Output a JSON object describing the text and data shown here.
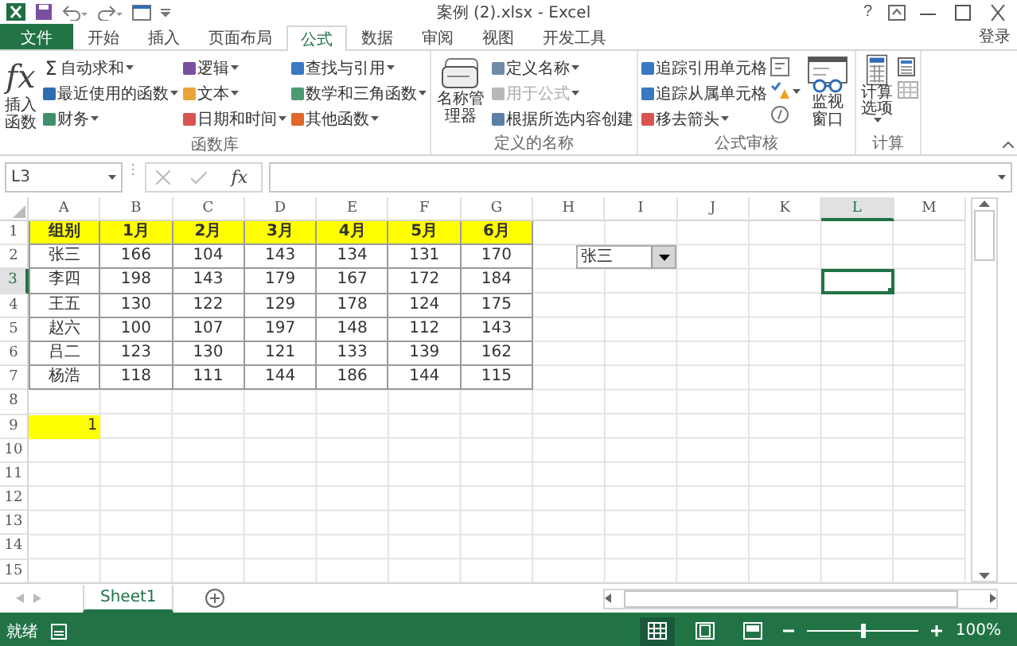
{
  "window": {
    "title": "案例 (2).xlsx - Excel",
    "help": "?"
  },
  "tabs": [
    {
      "label": "文件",
      "kind": "file",
      "selected": false
    },
    {
      "label": "开始",
      "kind": "tab",
      "selected": false
    },
    {
      "label": "插入",
      "kind": "tab",
      "selected": false
    },
    {
      "label": "页面布局",
      "kind": "tab",
      "selected": false
    },
    {
      "label": "公式",
      "kind": "tab",
      "selected": true
    },
    {
      "label": "数据",
      "kind": "tab",
      "selected": false
    },
    {
      "label": "审阅",
      "kind": "tab",
      "selected": false
    },
    {
      "label": "视图",
      "kind": "tab",
      "selected": false
    },
    {
      "label": "开发工具",
      "kind": "tab",
      "selected": false
    }
  ],
  "account": {
    "label": "登录"
  },
  "ribbon": {
    "groups": [
      {
        "label": "函数库",
        "controls": [
          {
            "kind": "function_button",
            "label": "插入函数",
            "symbol": "fx",
            "dropdown": false
          },
          {
            "kind": "stack",
            "items": [
              {
                "label": "自动求和",
                "symbol": "Σ",
                "dropdown": true,
                "disabled": false
              },
              {
                "label": "最近使用的函数",
                "color": "#2e6db4",
                "dropdown": true,
                "disabled": false
              },
              {
                "label": "财务",
                "color": "#3f8f6b",
                "dropdown": true,
                "disabled": false
              }
            ]
          },
          {
            "kind": "stack",
            "items": [
              {
                "label": "逻辑",
                "color": "#7b4fa0",
                "dropdown": true,
                "disabled": false
              },
              {
                "label": "文本",
                "color": "#e8a53a",
                "dropdown": true,
                "disabled": false
              },
              {
                "label": "日期和时间",
                "color": "#d9534f",
                "dropdown": true,
                "disabled": false
              }
            ]
          },
          {
            "kind": "stack",
            "items": [
              {
                "label": "查找与引用",
                "color": "#3a78c2",
                "dropdown": true,
                "disabled": false
              },
              {
                "label": "数学和三角函数",
                "color": "#4c9a72",
                "dropdown": true,
                "disabled": false
              },
              {
                "label": "其他函数",
                "color": "#e0662a",
                "dropdown": true,
                "disabled": false
              }
            ]
          }
        ]
      },
      {
        "label": "定义的名称",
        "controls": [
          {
            "kind": "name_manager",
            "label": "名称管理器",
            "dropdown": false
          },
          {
            "kind": "stack",
            "items": [
              {
                "label": "定义名称",
                "color": "#6f8ba8",
                "dropdown": true,
                "disabled": false
              },
              {
                "label": "用于公式",
                "color": "#b8b8b8",
                "dropdown": true,
                "disabled": true
              },
              {
                "label": "根据所选内容创建",
                "color": "#5b7fa6",
                "dropdown": false,
                "disabled": false
              }
            ]
          }
        ]
      },
      {
        "label": "公式审核",
        "controls": [
          {
            "kind": "stack",
            "items": [
              {
                "label": "追踪引用单元格",
                "color": "#3a78c2",
                "dropdown": false,
                "disabled": false
              },
              {
                "label": "追踪从属单元格",
                "color": "#3a78c2",
                "dropdown": false,
                "disabled": false
              },
              {
                "label": "移去箭头",
                "color": "#d9534f",
                "dropdown": true,
                "disabled": false
              }
            ]
          },
          {
            "kind": "icon_column",
            "items": [
              {
                "kind": "formulas",
                "dropdown": false
              },
              {
                "kind": "error_check",
                "dropdown": true
              },
              {
                "kind": "evaluate",
                "dropdown": false
              }
            ]
          },
          {
            "kind": "watch_window",
            "label": "监视窗口",
            "dropdown": false
          }
        ]
      },
      {
        "label": "计算",
        "controls": [
          {
            "kind": "calc_options",
            "label": "计算选项",
            "dropdown": true
          },
          {
            "kind": "icon_column",
            "items": [
              {
                "kind": "calculate_now",
                "dropdown": false
              },
              {
                "kind": "calculate_sheet",
                "dropdown": false
              }
            ]
          }
        ]
      }
    ]
  },
  "name_box": {
    "value": "L3"
  },
  "formula_bar": {
    "fx": "fx"
  },
  "sheet": {
    "columns": [
      {
        "label": "A",
        "selected": false
      },
      {
        "label": "B",
        "selected": false
      },
      {
        "label": "C",
        "selected": false
      },
      {
        "label": "D",
        "selected": false
      },
      {
        "label": "E",
        "selected": false
      },
      {
        "label": "F",
        "selected": false
      },
      {
        "label": "G",
        "selected": false
      },
      {
        "label": "H",
        "selected": false
      },
      {
        "label": "I",
        "selected": false
      },
      {
        "label": "J",
        "selected": false
      },
      {
        "label": "K",
        "selected": false
      },
      {
        "label": "L",
        "selected": true
      },
      {
        "label": "M",
        "selected": false
      }
    ],
    "rows": [
      {
        "label": "1",
        "selected": false
      },
      {
        "label": "2",
        "selected": false
      },
      {
        "label": "3",
        "selected": true
      },
      {
        "label": "4",
        "selected": false
      },
      {
        "label": "5",
        "selected": false
      },
      {
        "label": "6",
        "selected": false
      },
      {
        "label": "7",
        "selected": false
      },
      {
        "label": "8",
        "selected": false
      },
      {
        "label": "9",
        "selected": false
      },
      {
        "label": "10",
        "selected": false
      },
      {
        "label": "11",
        "selected": false
      },
      {
        "label": "12",
        "selected": false
      },
      {
        "label": "13",
        "selected": false
      },
      {
        "label": "14",
        "selected": false
      },
      {
        "label": "15",
        "selected": false
      }
    ],
    "table": {
      "header_highlighted": true,
      "header": [
        "组别",
        "1月",
        "2月",
        "3月",
        "4月",
        "5月",
        "6月"
      ],
      "rows": [
        [
          "张三",
          "166",
          "104",
          "143",
          "134",
          "131",
          "170"
        ],
        [
          "李四",
          "198",
          "143",
          "179",
          "167",
          "172",
          "184"
        ],
        [
          "王五",
          "130",
          "122",
          "129",
          "178",
          "124",
          "175"
        ],
        [
          "赵六",
          "100",
          "107",
          "197",
          "148",
          "112",
          "143"
        ],
        [
          "吕二",
          "123",
          "130",
          "121",
          "133",
          "139",
          "162"
        ],
        [
          "杨浩",
          "118",
          "111",
          "144",
          "186",
          "144",
          "115"
        ]
      ]
    },
    "result_cell": {
      "value": "1",
      "highlighted": true
    },
    "combo_box": {
      "value": "张三"
    }
  },
  "sheet_tabs": [
    {
      "label": "Sheet1",
      "selected": true
    }
  ],
  "status_bar": {
    "status": "就绪",
    "views": [
      {
        "kind": "normal",
        "selected": true
      },
      {
        "kind": "page_layout",
        "selected": false
      },
      {
        "kind": "page_break",
        "selected": false
      }
    ],
    "zoom": {
      "level": 0.5,
      "label": "100%"
    }
  }
}
